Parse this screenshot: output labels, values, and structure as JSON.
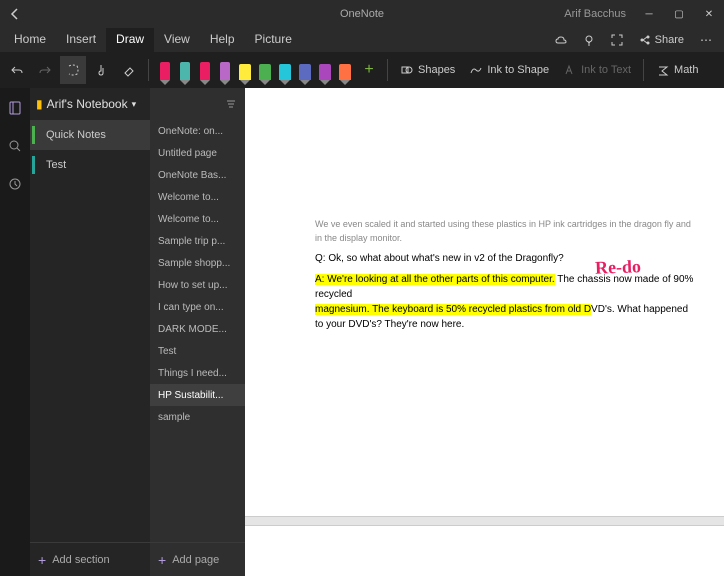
{
  "titlebar": {
    "app_title": "OneNote",
    "user": "Arif Bacchus"
  },
  "menu": {
    "items": [
      "Home",
      "Insert",
      "Draw",
      "View",
      "Help",
      "Picture"
    ],
    "active": 2,
    "share": "Share"
  },
  "toolbar": {
    "pens": [
      {
        "color": "#e91e63",
        "type": "pen"
      },
      {
        "color": "#4db6ac",
        "type": "pen"
      },
      {
        "color": "#e91e63",
        "type": "pen"
      },
      {
        "color": "#ba68c8",
        "type": "pen"
      },
      {
        "color": "#ffeb3b",
        "type": "hl"
      },
      {
        "color": "#4caf50",
        "type": "hl"
      },
      {
        "color": "#26c6da",
        "type": "hl"
      },
      {
        "color": "#5c6bc0",
        "type": "hl"
      },
      {
        "color": "#ab47bc",
        "type": "hl"
      },
      {
        "color": "#ff7043",
        "type": "hl"
      }
    ],
    "shapes": "Shapes",
    "ink_to_shape": "Ink to Shape",
    "ink_to_text": "Ink to Text",
    "math": "Math"
  },
  "notebook": {
    "name": "Arif's Notebook"
  },
  "sections": [
    {
      "label": "Quick Notes",
      "color": "c-green",
      "active": true
    },
    {
      "label": "Test",
      "color": "c-teal",
      "active": false
    }
  ],
  "add_section": "Add section",
  "pages": [
    "OneNote: on...",
    "Untitled page",
    "OneNote Bas...",
    "Welcome to...",
    "Welcome to...",
    "Sample trip p...",
    "Sample shopp...",
    "How to set up...",
    "I can type on...",
    "DARK MODE...",
    "Test",
    "Things I need...",
    "HP Sustabilit...",
    "sample"
  ],
  "active_page_index": 12,
  "add_page": "Add page",
  "note": {
    "clipped": "We ve even scaled it and started using these plastics in HP ink cartridges in the dragon fly and in the display monitor.",
    "q": "Q: Ok, so what about what's new in v2 of the Dragonfly?",
    "a_hl": "A: We're looking at all the other parts of this computer.",
    "a_mid": " The chassis now made of 90% recycled ",
    "a_hl2": "magnesium. The keyboard is 50% recycled plastics from old D",
    "a_rest": "VD's. What happened to your DVD's? They're now here.",
    "ink": "Re-do"
  }
}
